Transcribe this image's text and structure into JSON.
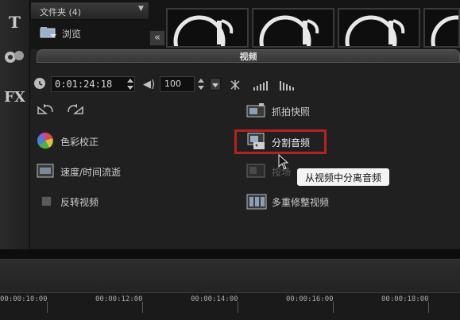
{
  "toolstrip": {
    "items": [
      {
        "label": "T",
        "icon": "title-icon"
      },
      {
        "label": "",
        "icon": "graphics-icon"
      },
      {
        "label": "FX",
        "icon": "filter-icon"
      }
    ]
  },
  "library": {
    "folder_label": "文件夹 (4)",
    "browse_label": "浏览",
    "collapse_glyph": "«"
  },
  "panel": {
    "title": "视频",
    "timecode": "0:01:24:18",
    "volume": "100",
    "items_left": [
      {
        "label": "色彩校正",
        "icon": "color-correction-icon"
      },
      {
        "label": "速度/时间流逝",
        "icon": "speed-icon"
      },
      {
        "label": "反转视频",
        "icon": "reverse-checkbox"
      }
    ],
    "items_right": [
      {
        "label": "抓拍快照",
        "icon": "snapshot-icon"
      },
      {
        "label": "分割音频",
        "icon": "split-audio-icon"
      },
      {
        "label": "按场",
        "icon": "scene-icon"
      },
      {
        "label": "多重修整视频",
        "icon": "multi-trim-icon"
      }
    ],
    "tooltip": "从视频中分离音频"
  },
  "timeline": {
    "ticks": [
      "00:00:10:00",
      "00:00:12:00",
      "00:00:14:00",
      "00:00:16:00",
      "00:00:18:00"
    ]
  },
  "colors": {
    "highlight": "#b22222",
    "panel_bg": "#202020"
  }
}
